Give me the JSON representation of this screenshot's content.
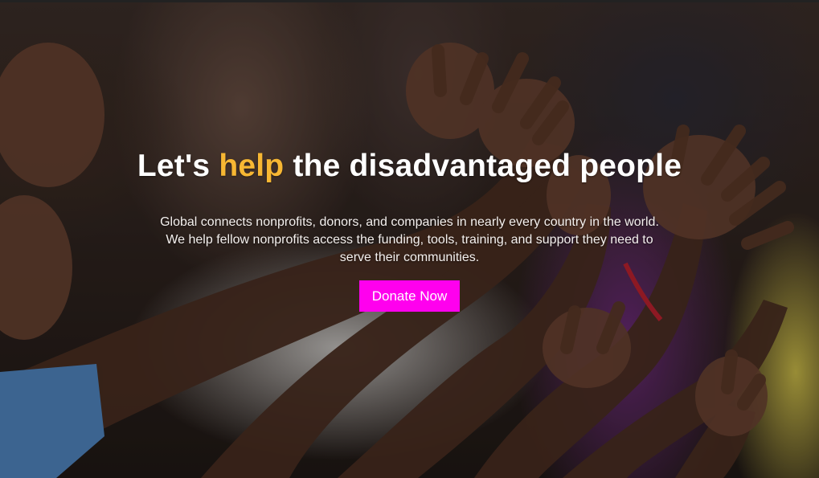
{
  "hero": {
    "headline_start": "Let's ",
    "headline_accent": "help",
    "headline_end": " the disadvantaged people",
    "description_line1": "Global connects nonprofits, donors, and companies in nearly every country in the world.",
    "description_line2": "We help fellow nonprofits access the funding, tools, training, and support they need to",
    "description_line3": "serve their communities.",
    "cta_label": "Donate Now"
  },
  "colors": {
    "accent": "#f7b733",
    "cta_background": "#ff00ee",
    "text": "#ffffff"
  }
}
